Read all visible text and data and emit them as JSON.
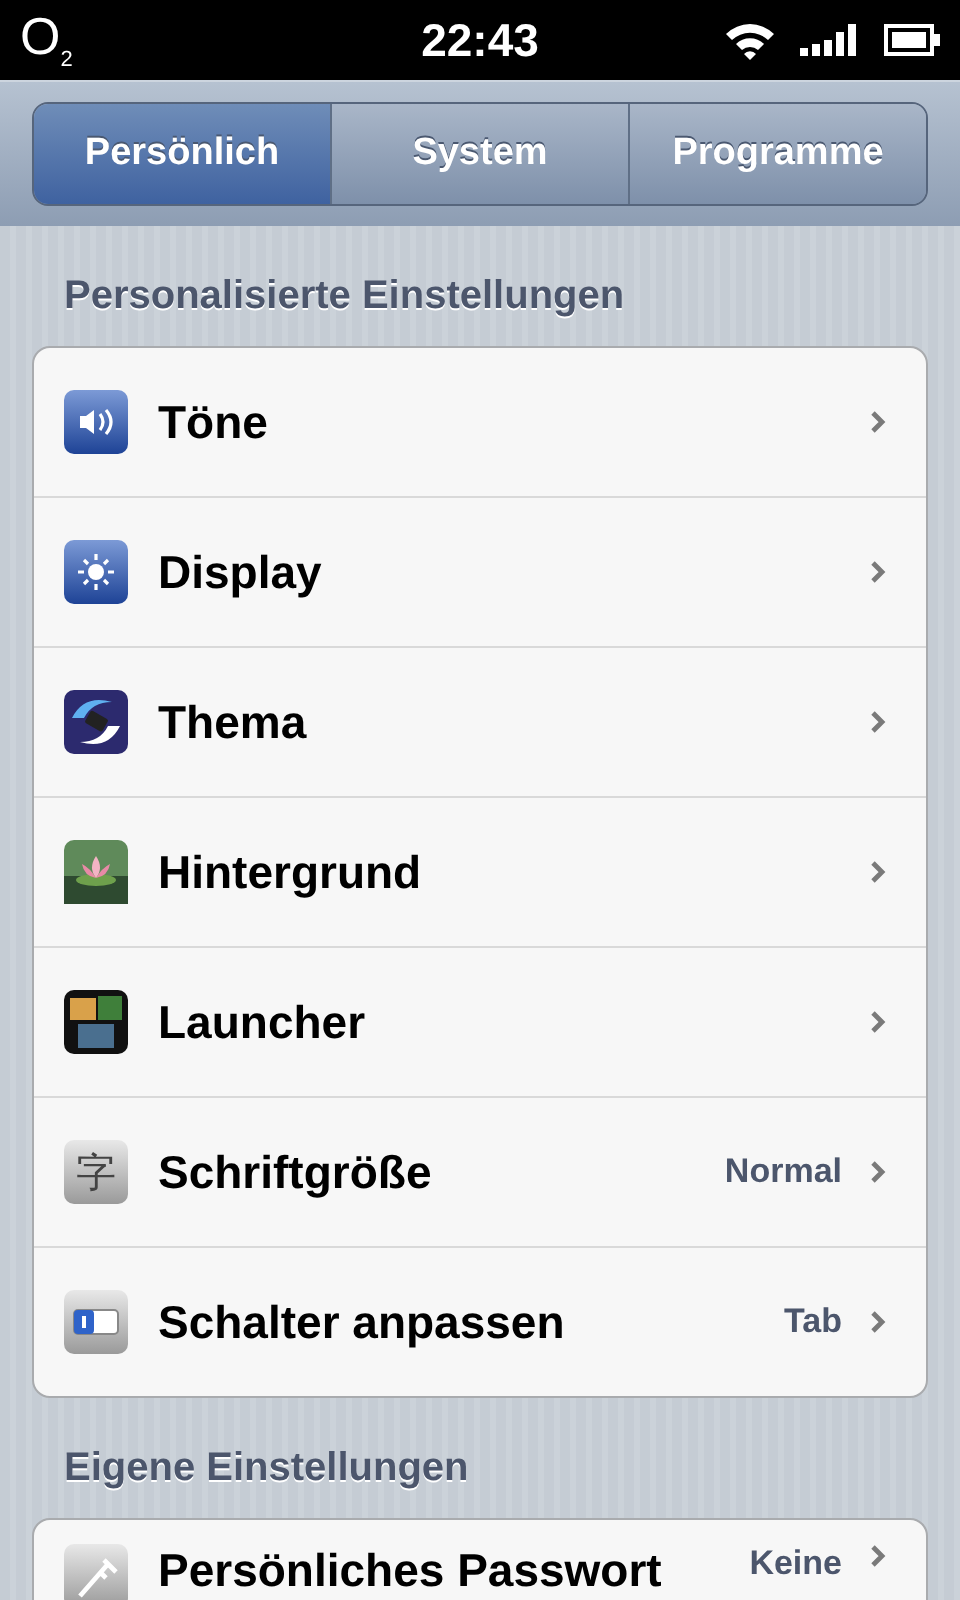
{
  "status_bar": {
    "carrier": "O",
    "carrier_sub": "2",
    "time": "22:43"
  },
  "tabs": [
    {
      "label": "Persönlich",
      "selected": true
    },
    {
      "label": "System",
      "selected": false
    },
    {
      "label": "Programme",
      "selected": false
    }
  ],
  "sections": [
    {
      "title": "Personalisierte Einstellungen",
      "items": [
        {
          "label": "Töne",
          "kind": "sound"
        },
        {
          "label": "Display",
          "kind": "brightness"
        },
        {
          "label": "Thema",
          "kind": "theme"
        },
        {
          "label": "Hintergrund",
          "kind": "flower"
        },
        {
          "label": "Launcher",
          "kind": "launcher"
        },
        {
          "label": "Schriftgröße",
          "kind": "glyph",
          "icon_text": "字",
          "value": "Normal"
        },
        {
          "label": "Schalter anpassen",
          "kind": "switch",
          "value": "Tab"
        }
      ]
    },
    {
      "title": "Eigene Einstellungen",
      "items": [
        {
          "label": "Persönliches Passwort",
          "kind": "key",
          "value": "Keine"
        }
      ]
    }
  ]
}
